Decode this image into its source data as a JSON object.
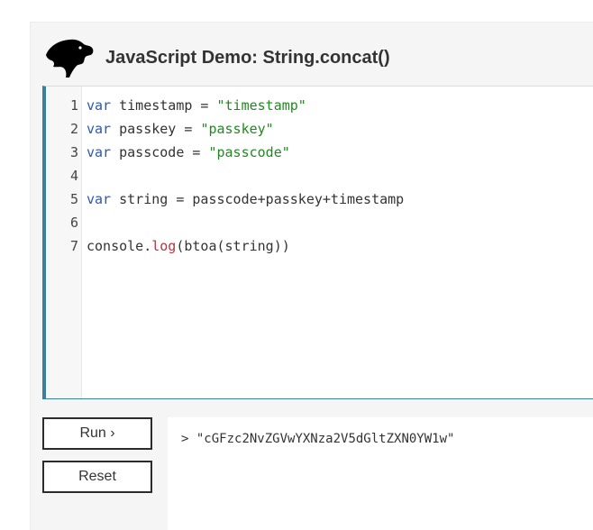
{
  "header": {
    "title": "JavaScript Demo: String.concat()",
    "logo_icon": "dinosaur-head-icon"
  },
  "editor": {
    "lines": [
      {
        "number": "1",
        "tokens": [
          {
            "text": "var",
            "type": "kw"
          },
          {
            "text": " timestamp = ",
            "type": "plain"
          },
          {
            "text": "\"timestamp\"",
            "type": "str"
          }
        ]
      },
      {
        "number": "2",
        "tokens": [
          {
            "text": "var",
            "type": "kw"
          },
          {
            "text": " passkey = ",
            "type": "plain"
          },
          {
            "text": "\"passkey\"",
            "type": "str"
          }
        ]
      },
      {
        "number": "3",
        "tokens": [
          {
            "text": "var",
            "type": "kw"
          },
          {
            "text": " passcode = ",
            "type": "plain"
          },
          {
            "text": "\"passcode\"",
            "type": "str"
          }
        ]
      },
      {
        "number": "4",
        "tokens": []
      },
      {
        "number": "5",
        "tokens": [
          {
            "text": "var",
            "type": "kw"
          },
          {
            "text": " string = passcode+passkey+timestamp",
            "type": "plain"
          }
        ]
      },
      {
        "number": "6",
        "tokens": []
      },
      {
        "number": "7",
        "tokens": [
          {
            "text": "console.",
            "type": "plain"
          },
          {
            "text": "log",
            "type": "fn"
          },
          {
            "text": "(btoa(string))",
            "type": "plain"
          }
        ]
      }
    ]
  },
  "buttons": {
    "run_label": "Run ›",
    "reset_label": "Reset"
  },
  "output": {
    "prompt": ">",
    "text": "\"cGFzc2NvZGVwYXNza2V5dGltZXN0YW1w\""
  },
  "colors": {
    "accent": "#3b7f9c",
    "keyword": "#2c57b5",
    "string": "#228822",
    "function": "#b5343f"
  }
}
